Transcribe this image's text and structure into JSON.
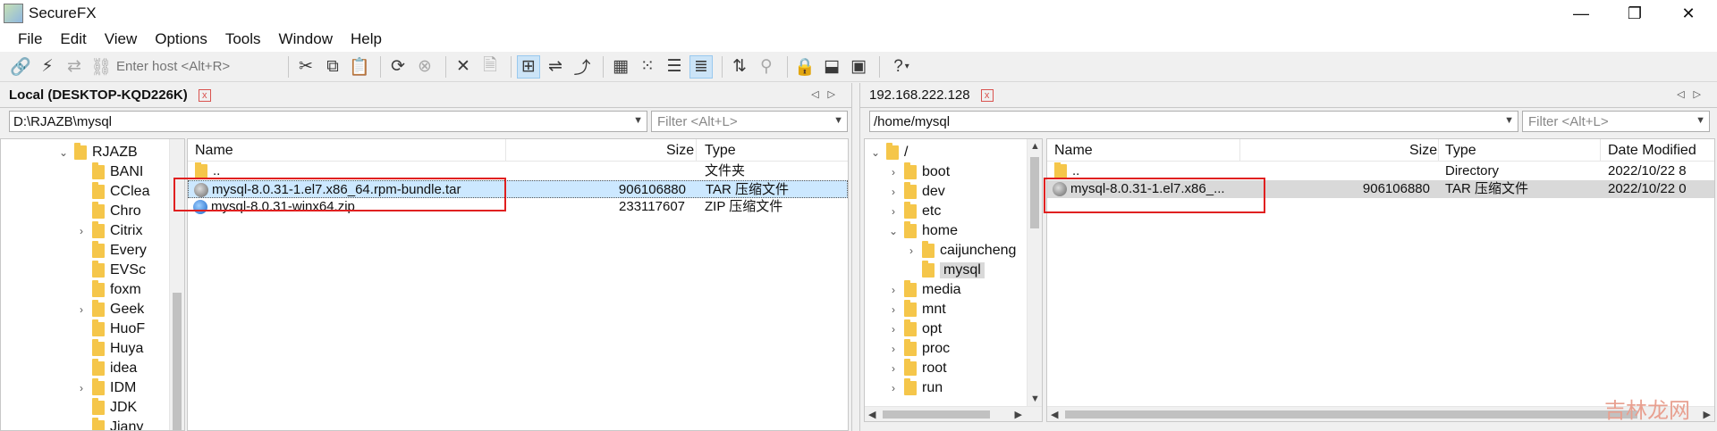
{
  "window": {
    "title": "SecureFX",
    "minimize": "—",
    "maximize": "❐",
    "close": "✕"
  },
  "menu": [
    "File",
    "Edit",
    "View",
    "Options",
    "Tools",
    "Window",
    "Help"
  ],
  "toolbar": {
    "host_placeholder": "Enter host <Alt+R>",
    "help": "?"
  },
  "local": {
    "title": "Local (DESKTOP-KQD226K)",
    "close": "x",
    "path": "D:\\RJAZB\\mysql",
    "filter_placeholder": "Filter <Alt+L>",
    "tree": [
      {
        "label": "RJAZB",
        "chev": "expanded",
        "indent": 0
      },
      {
        "label": "BANI",
        "chev": "none",
        "indent": 1
      },
      {
        "label": "CClea",
        "chev": "none",
        "indent": 1
      },
      {
        "label": "Chro",
        "chev": "none",
        "indent": 1
      },
      {
        "label": "Citrix",
        "chev": "collapsed",
        "indent": 1
      },
      {
        "label": "Every",
        "chev": "none",
        "indent": 1
      },
      {
        "label": "EVSc",
        "chev": "none",
        "indent": 1
      },
      {
        "label": "foxm",
        "chev": "none",
        "indent": 1
      },
      {
        "label": "Geek",
        "chev": "collapsed",
        "indent": 1
      },
      {
        "label": "HuoF",
        "chev": "none",
        "indent": 1
      },
      {
        "label": "Huya",
        "chev": "none",
        "indent": 1
      },
      {
        "label": "idea",
        "chev": "none",
        "indent": 1
      },
      {
        "label": "IDM",
        "chev": "collapsed",
        "indent": 1
      },
      {
        "label": "JDK",
        "chev": "none",
        "indent": 1
      },
      {
        "label": "Jiany",
        "chev": "none",
        "indent": 1
      }
    ],
    "columns": {
      "name": "Name",
      "size": "Size",
      "type": "Type"
    },
    "files": [
      {
        "name": "..",
        "size": "",
        "type": "文件夹",
        "icon": "folder-icon"
      },
      {
        "name": "mysql-8.0.31-1.el7.x86_64.rpm-bundle.tar",
        "size": "906106880",
        "type": "TAR 压缩文件",
        "icon": "tar-icon"
      },
      {
        "name": "mysql-8.0.31-winx64.zip",
        "size": "233117607",
        "type": "ZIP 压缩文件",
        "icon": "zip-icon"
      }
    ]
  },
  "remote": {
    "title": "192.168.222.128",
    "close": "x",
    "path": "/home/mysql",
    "filter_placeholder": "Filter <Alt+L>",
    "tree": [
      {
        "label": "/",
        "chev": "expanded",
        "indent": 0
      },
      {
        "label": "boot",
        "chev": "collapsed",
        "indent": 1
      },
      {
        "label": "dev",
        "chev": "collapsed",
        "indent": 1
      },
      {
        "label": "etc",
        "chev": "collapsed",
        "indent": 1
      },
      {
        "label": "home",
        "chev": "expanded",
        "indent": 1
      },
      {
        "label": "caijuncheng",
        "chev": "collapsed",
        "indent": 2
      },
      {
        "label": "mysql",
        "chev": "none",
        "indent": 2
      },
      {
        "label": "media",
        "chev": "collapsed",
        "indent": 1
      },
      {
        "label": "mnt",
        "chev": "collapsed",
        "indent": 1
      },
      {
        "label": "opt",
        "chev": "collapsed",
        "indent": 1
      },
      {
        "label": "proc",
        "chev": "collapsed",
        "indent": 1
      },
      {
        "label": "root",
        "chev": "collapsed",
        "indent": 1
      },
      {
        "label": "run",
        "chev": "collapsed",
        "indent": 1
      }
    ],
    "columns": {
      "name": "Name",
      "size": "Size",
      "type": "Type",
      "date": "Date Modified"
    },
    "files": [
      {
        "name": "..",
        "size": "",
        "type": "Directory",
        "date": "2022/10/22 8",
        "icon": "folder-icon"
      },
      {
        "name": "mysql-8.0.31-1.el7.x86_...",
        "size": "906106880",
        "type": "TAR 压缩文件",
        "date": "2022/10/22 0",
        "icon": "tar-icon"
      }
    ]
  },
  "watermark": "吉林龙网"
}
